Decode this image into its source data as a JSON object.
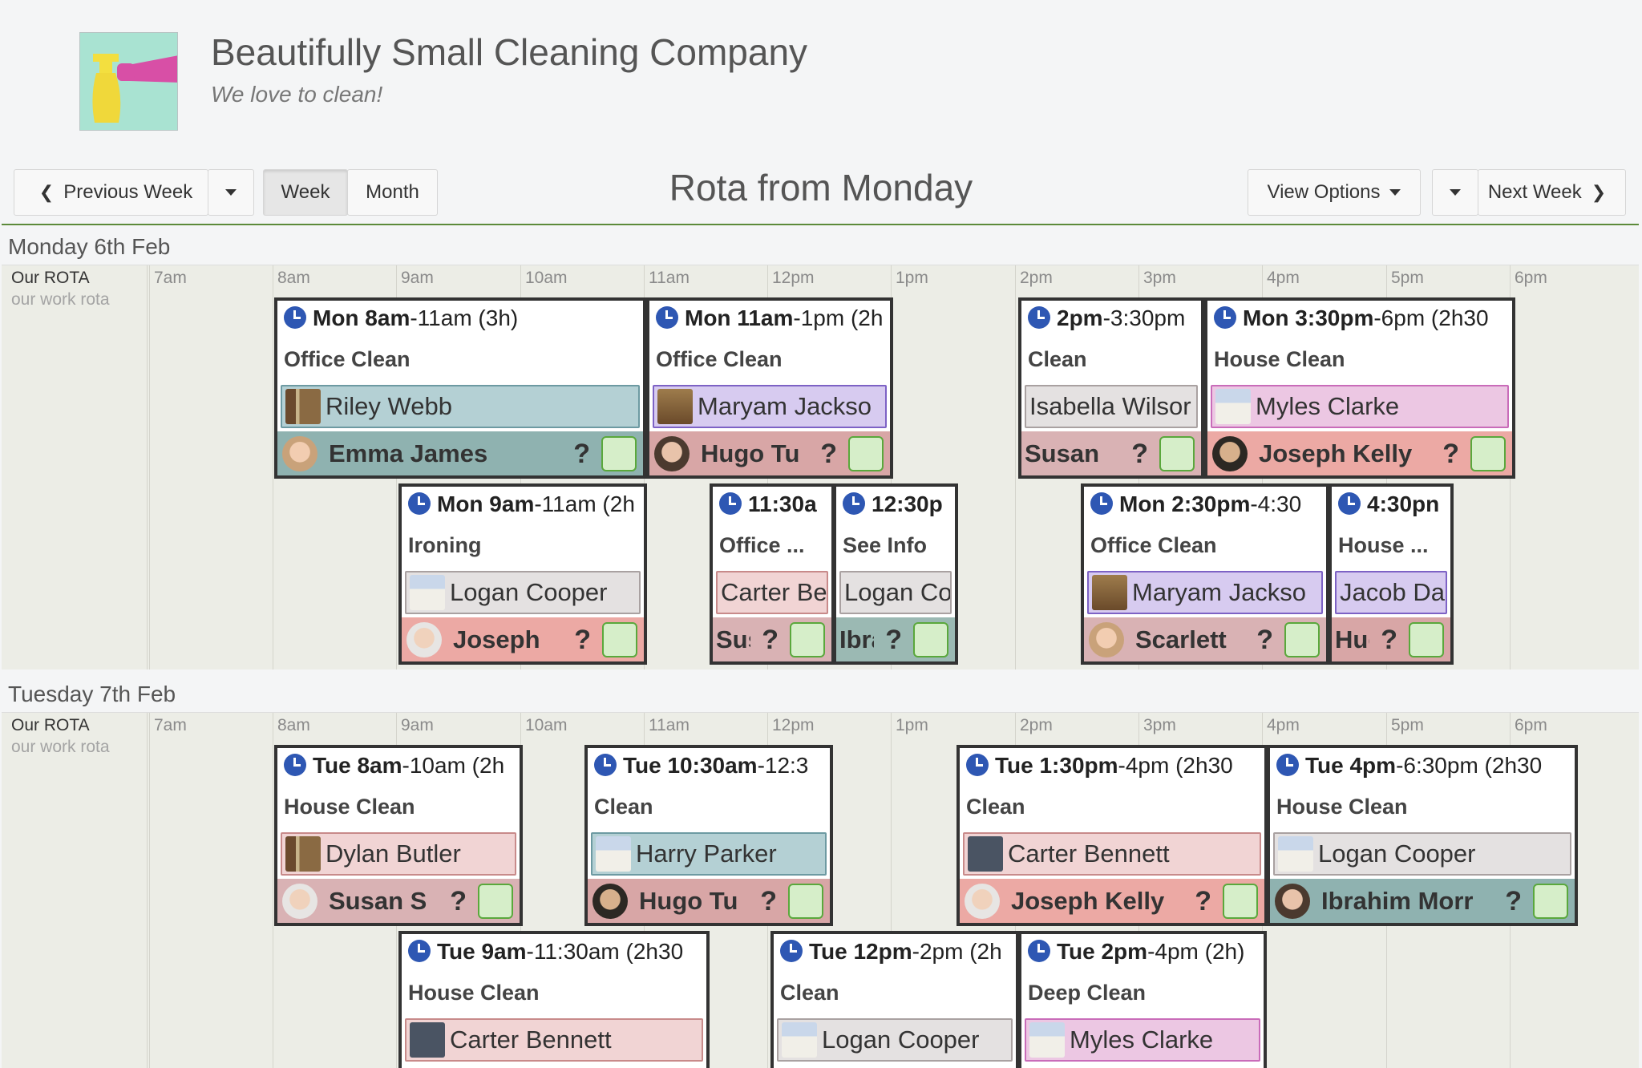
{
  "company": {
    "name": "Beautifully Small Cleaning Company",
    "tagline": "We love to clean!"
  },
  "toolbar": {
    "prev_week": "Previous Week",
    "week": "Week",
    "month": "Month",
    "title": "Rota from Monday",
    "view_options": "View Options",
    "next_week": "Next Week"
  },
  "hours": [
    "7am",
    "8am",
    "9am",
    "10am",
    "11am",
    "12pm",
    "1pm",
    "2pm",
    "3pm",
    "4pm",
    "5pm",
    "6pm"
  ],
  "row_label": {
    "title": "Our ROTA",
    "sub": "our work rota"
  },
  "days": [
    {
      "title": "Monday 6th Feb",
      "shifts": [
        {
          "time_bold": "Mon 8am",
          "time_rest": "-11am (3h)",
          "job": "Office Clean",
          "location": "Riley Webb",
          "staff": "Emma James",
          "q": "?"
        },
        {
          "time_bold": "Mon 11am",
          "time_rest": "-1pm (2h",
          "job": "Office Clean",
          "location": "Maryam Jackso",
          "staff": "Hugo Tu",
          "q": "?"
        },
        {
          "time_bold": "2pm",
          "time_rest": "-3:30pm",
          "job": "Clean",
          "location": "Isabella Wilsor",
          "staff": "Susan",
          "q": "?"
        },
        {
          "time_bold": "Mon 3:30pm",
          "time_rest": "-6pm (2h30",
          "job": "House Clean",
          "location": "Myles Clarke",
          "staff": "Joseph Kelly",
          "q": "?"
        },
        {
          "time_bold": "Mon 9am",
          "time_rest": "-11am (2h",
          "job": "Ironing",
          "location": "Logan Cooper",
          "staff": "Joseph",
          "q": "?"
        },
        {
          "time_bold": "11:30a",
          "time_rest": "",
          "job": "Office ...",
          "location": "Carter Be",
          "staff": "Susa",
          "q": "?"
        },
        {
          "time_bold": "12:30p",
          "time_rest": "",
          "job": "See Info",
          "location": "Logan Co",
          "staff": "Ibra",
          "q": "?"
        },
        {
          "time_bold": "Mon 2:30pm",
          "time_rest": "-4:30",
          "job": "Office Clean",
          "location": "Maryam Jackso",
          "staff": "Scarlett",
          "q": "?"
        },
        {
          "time_bold": "4:30pn",
          "time_rest": "",
          "job": "House ...",
          "location": "Jacob Da",
          "staff": "Hug",
          "q": "?"
        }
      ]
    },
    {
      "title": "Tuesday 7th Feb",
      "shifts": [
        {
          "time_bold": "Tue 8am",
          "time_rest": "-10am (2h",
          "job": "House Clean",
          "location": "Dylan Butler",
          "staff": "Susan S",
          "q": "?"
        },
        {
          "time_bold": "Tue 10:30am",
          "time_rest": "-12:3",
          "job": "Clean",
          "location": "Harry Parker",
          "staff": "Hugo Tu",
          "q": "?"
        },
        {
          "time_bold": "Tue 1:30pm",
          "time_rest": "-4pm (2h30",
          "job": "Clean",
          "location": "Carter Bennett",
          "staff": "Joseph Kelly",
          "q": "?"
        },
        {
          "time_bold": "Tue 4pm",
          "time_rest": "-6:30pm (2h30",
          "job": "House Clean",
          "location": "Logan Cooper",
          "staff": "Ibrahim Morr",
          "q": "?"
        },
        {
          "time_bold": "Tue 9am",
          "time_rest": "-11:30am (2h30",
          "job": "House Clean",
          "location": "Carter Bennett"
        },
        {
          "time_bold": "Tue 12pm",
          "time_rest": "-2pm (2h",
          "job": "Clean",
          "location": "Logan Cooper"
        },
        {
          "time_bold": "Tue 2pm",
          "time_rest": "-4pm (2h)",
          "job": "Deep Clean",
          "location": "Myles Clarke"
        }
      ]
    }
  ]
}
